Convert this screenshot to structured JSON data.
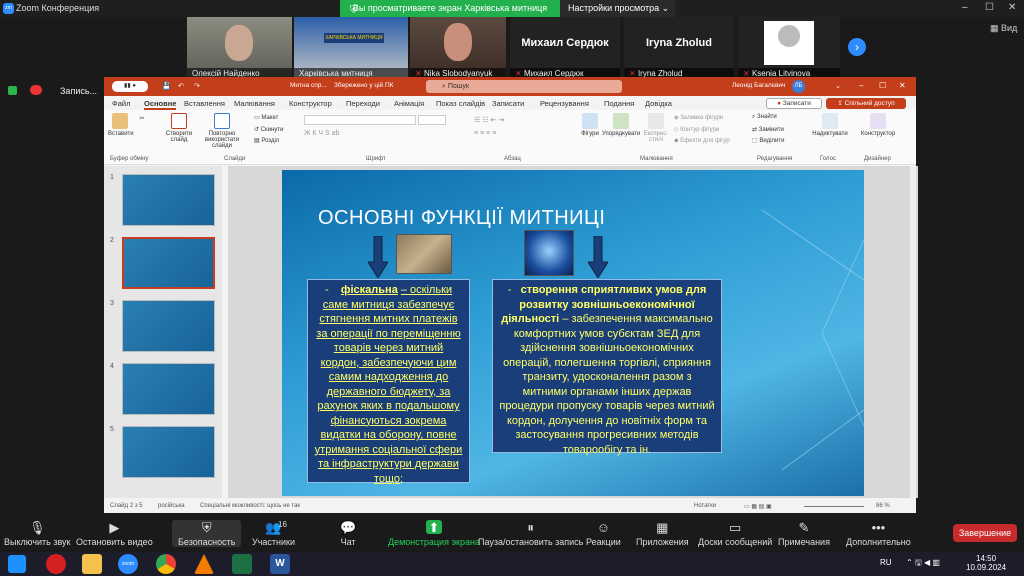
{
  "app": {
    "title": "Zoom Конференция",
    "share_banner": "Вы просматриваете экран Харківська митниця",
    "view_settings": "Настройки просмотра",
    "view_label": "Вид",
    "rec_label": "Запись..."
  },
  "participants": [
    {
      "name": "Олексій Найденко"
    },
    {
      "name": "Харківська митниця",
      "sign": "ХАРКІВСЬКА МИТНИЦЯ"
    },
    {
      "name": "Nika Slobodyanyuk"
    },
    {
      "name": "Михаил Сердюк"
    },
    {
      "name": "Iryna Zholud"
    },
    {
      "name": "Ksenia Litvinova"
    }
  ],
  "ppt": {
    "doc_name": "Митна спр...",
    "saved": "Збережено у цій ПК",
    "search": "Пошук",
    "user": "Леонід Багалєвич",
    "record": "Записати",
    "share": "Спільний доступ",
    "menu": [
      "Файл",
      "Основне",
      "Вставлення",
      "Малювання",
      "Конструктор",
      "Переходи",
      "Анімація",
      "Показ слайдів",
      "Записати",
      "Рецензування",
      "Подання",
      "Довідка"
    ],
    "ribbon": {
      "paste": "Вставити",
      "new_slide": "Створити слайд",
      "reuse": "Повторно використати слайди",
      "layout": "Макет",
      "reset": "Скинути",
      "section": "Розділ",
      "shapes": "Фігури",
      "arrange": "Упорядкувати",
      "quick_styles": "Експрес-стилі",
      "fill": "Заливка фігури",
      "outline": "Контур фігури",
      "effects": "Ефекти для фігур",
      "find": "Знайти",
      "replace": "Замінити",
      "select": "Виділити",
      "dictate": "Надиктувати",
      "designer": "Конструктор",
      "groups": [
        "Буфер обміну",
        "Слайди",
        "Шрифт",
        "Абзац",
        "Малювання",
        "Редагування",
        "Голос",
        "Дизайнер"
      ]
    },
    "thumb_numbers": [
      "1",
      "2",
      "3",
      "4",
      "5"
    ],
    "slide": {
      "title": "ОСНОВНІ ФУНКЦІЇ МИТНИЦІ",
      "left_box": {
        "dash": "-",
        "term": "фіскальна",
        "text": "– оскільки саме митниця забезпечує стягнення митних платежів за операції по переміщенню товарів через митний кордон, забезпечуючи цим самим надходження до державного бюджету, за рахунок яких в подальшому фінансуються зокрема видатки на оборону, повне утримання соціальної сфери та інфраструктури держави тощо;"
      },
      "right_box": {
        "dash": "-",
        "term": "створення сприятливих умов для розвитку зовнішньоекономічної діяльності",
        "text": "– забезпечення максимально комфортних умов субєктам ЗЕД для здійснення зовнішньоекономічних операцій, полегшення торгівлі, сприяння транзиту, удосконалення разом з митними органами інших держав процедури пропуску товарів через митний кордон, долучення до новітніх форм та застосування прогресивних   методів товарообігу та ін."
      }
    },
    "status": {
      "slide": "Слайд 2 з 5",
      "lang": "російська",
      "access": "Спеціальні можливості: щось не так",
      "notes": "Нотатки",
      "zoom": "86 %"
    }
  },
  "toolbar": [
    {
      "label": "Выключить звук",
      "icon": "mic-icon"
    },
    {
      "label": "Остановить видео",
      "icon": "video-icon"
    },
    {
      "label": "Безопасность",
      "icon": "shield-icon"
    },
    {
      "label": "Участники",
      "icon": "participants-icon",
      "count": "16"
    },
    {
      "label": "Чат",
      "icon": "chat-icon"
    },
    {
      "label": "Демонстрация экрана",
      "icon": "share-icon"
    },
    {
      "label": "Пауза/остановить запись",
      "icon": "pause-icon"
    },
    {
      "label": "Реакции",
      "icon": "reaction-icon"
    },
    {
      "label": "Приложения",
      "icon": "apps-icon"
    },
    {
      "label": "Доски сообщений",
      "icon": "whiteboard-icon"
    },
    {
      "label": "Примечания",
      "icon": "notes-icon"
    },
    {
      "label": "Дополнительно",
      "icon": "more-icon"
    }
  ],
  "end_label": "Завершение",
  "taskbar": {
    "lang": "RU",
    "time": "14:50",
    "date": "10.09.2024"
  }
}
